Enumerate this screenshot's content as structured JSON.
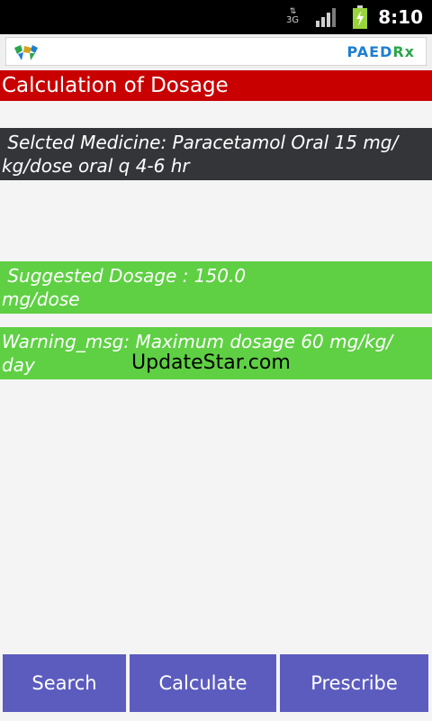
{
  "status_bar": {
    "network_type": "3G",
    "time": "8:10",
    "icons": [
      "data-arrows-icon",
      "signal-strength-icon",
      "battery-charging-icon"
    ]
  },
  "header": {
    "logo_part1": "PAED",
    "logo_part2": "Rx",
    "colors": {
      "logo_blue": "#1d7fd0",
      "logo_green": "#2aa64b"
    }
  },
  "title_bar": {
    "title": "Calculation of Dosage",
    "color": "#c80000"
  },
  "medicine": {
    "line1": " Selcted Medicine: Paracetamol Oral 15 mg/",
    "line2": "kg/dose oral q 4-6 hr"
  },
  "dosage": {
    "line1": " Suggested Dosage : 150.0",
    "line2": "mg/dose"
  },
  "warning": {
    "line1": "Warning_msg: Maximum dosage 60 mg/kg/",
    "line2": "day"
  },
  "watermark": "UpdateStar.com",
  "buttons": {
    "search": "Search",
    "calculate": "Calculate",
    "prescribe": "Prescribe",
    "color": "#5c5cbf"
  }
}
